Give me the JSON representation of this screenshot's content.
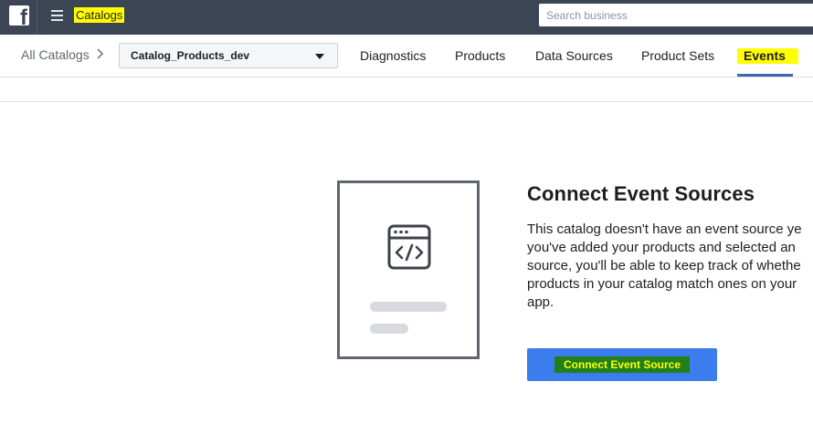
{
  "topbar": {
    "logo_letter": "f",
    "logo_icon": "facebook-logo-icon",
    "menu_icon": "hamburger-menu-icon",
    "app_title": "Catalogs",
    "search_placeholder": "Search business"
  },
  "subnav": {
    "all_catalogs": "All Catalogs",
    "chevron_icon": "chevron-right-icon",
    "catalog_selected": "Catalog_Products_dev",
    "tabs": [
      {
        "label": "Diagnostics"
      },
      {
        "label": "Products"
      },
      {
        "label": "Data Sources"
      },
      {
        "label": "Product Sets"
      },
      {
        "label": "Events",
        "active": true
      }
    ]
  },
  "main": {
    "illustration_icon": "code-window-icon",
    "heading": "Connect Event Sources",
    "body_lines": [
      "This catalog doesn't have an event source ye",
      "you've added your products and selected an",
      "source, you'll be able to keep track of whethe",
      "products in your catalog match ones on your",
      "app."
    ],
    "button_label": "Connect Event Source"
  },
  "colors": {
    "topbar": "#3b4554",
    "highlight": "#ffff00",
    "tab_underline": "#4267b2",
    "button_bg": "#3b7ded",
    "button_label_bg": "#217f1c"
  }
}
